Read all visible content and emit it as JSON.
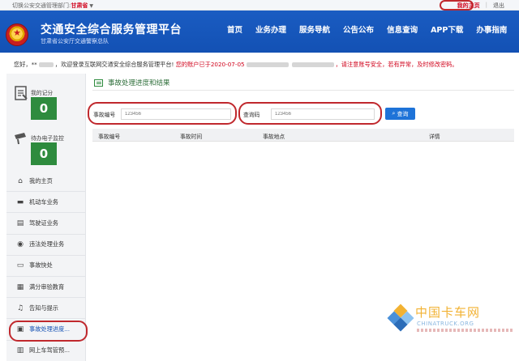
{
  "topbar": {
    "switch_prefix": "切换公安交通管理部门:",
    "province": "甘肃省",
    "my_home": "我的主页",
    "logout": "退出"
  },
  "header": {
    "title": "交通安全综合服务管理平台",
    "subtitle": "甘肃省公安厅交通警察总队",
    "nav": [
      "首页",
      "业务办理",
      "服务导航",
      "公告公布",
      "信息查询",
      "APP下载",
      "办事指南"
    ]
  },
  "welcome": {
    "greeting": "您好，**",
    "message": "，欢迎登录互联网交通安全综合服务管理平台!",
    "account_notice": "您的账户已于2020-07-05",
    "warning": "，请注意账号安全，若有异常，及时修改密码。"
  },
  "sidebar": {
    "stats": [
      {
        "label": "我的记分",
        "value": "0",
        "icon": "clipboard-icon"
      },
      {
        "label": "待办电子监控",
        "value": "0",
        "icon": "camera-icon"
      }
    ],
    "menu": [
      {
        "label": "我的主页",
        "icon": "home-icon"
      },
      {
        "label": "机动车业务",
        "icon": "car-icon"
      },
      {
        "label": "驾驶证业务",
        "icon": "id-card-icon"
      },
      {
        "label": "违法处理业务",
        "icon": "camera-icon"
      },
      {
        "label": "事故快处",
        "icon": "crash-icon"
      },
      {
        "label": "满分审验教育",
        "icon": "book-icon"
      },
      {
        "label": "告知与提示",
        "icon": "bell-icon"
      },
      {
        "label": "事故处理进度...",
        "icon": "search-doc-icon",
        "active": true
      },
      {
        "label": "网上车驾管预...",
        "icon": "calendar-icon"
      }
    ]
  },
  "main": {
    "title": "事故处理进度和结果",
    "fields": [
      {
        "label": "事故编号",
        "placeholder": "123456"
      },
      {
        "label": "查询码",
        "placeholder": "123456"
      }
    ],
    "query_button": "查询",
    "table_headers": [
      "事故编号",
      "事故时间",
      "事故地点",
      "详情"
    ]
  },
  "watermark": {
    "cn": "中国卡车网",
    "en": "CHINATRUCK.ORG"
  },
  "colors": {
    "header_blue": "#1351b4",
    "stat_green": "#2e8b3e",
    "highlight_red": "#c0282d",
    "button_blue": "#1e73d8"
  }
}
